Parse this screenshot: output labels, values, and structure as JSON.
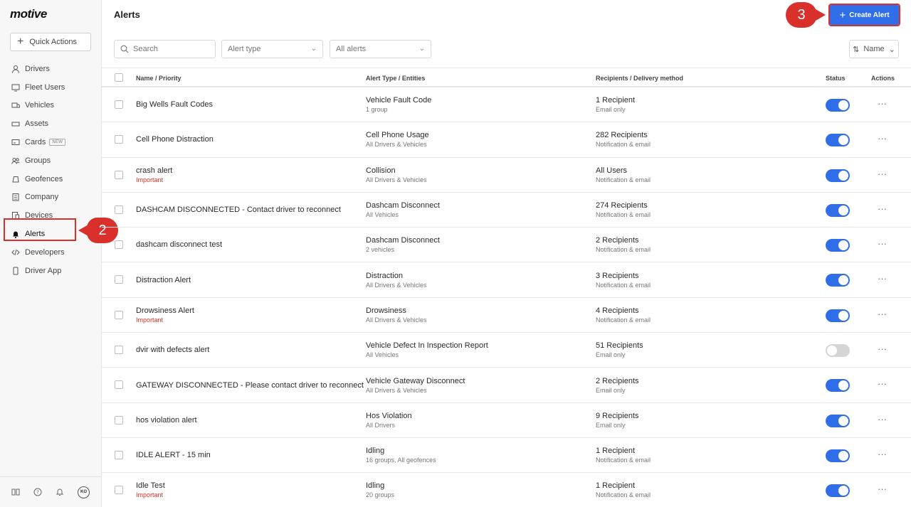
{
  "app": {
    "logo": "motive",
    "page_title": "Alerts"
  },
  "sidebar": {
    "quick_actions": "Quick Actions",
    "items": [
      {
        "label": "Drivers",
        "icon": "user-icon"
      },
      {
        "label": "Fleet Users",
        "icon": "monitor-icon"
      },
      {
        "label": "Vehicles",
        "icon": "vehicle-icon"
      },
      {
        "label": "Assets",
        "icon": "asset-icon"
      },
      {
        "label": "Cards",
        "icon": "card-icon",
        "badge": "NEW"
      },
      {
        "label": "Groups",
        "icon": "groups-icon"
      },
      {
        "label": "Geofences",
        "icon": "geofence-icon"
      },
      {
        "label": "Company",
        "icon": "building-icon"
      },
      {
        "label": "Devices",
        "icon": "devices-icon"
      },
      {
        "label": "Alerts",
        "icon": "bell-icon",
        "active": true
      },
      {
        "label": "Developers",
        "icon": "code-icon"
      },
      {
        "label": "Driver App",
        "icon": "phone-icon"
      }
    ],
    "footer": {
      "avatar": "KO"
    }
  },
  "markers": {
    "step2": "2",
    "step3": "3"
  },
  "toolbar": {
    "create_alert": "Create Alert",
    "search_placeholder": "Search",
    "alert_type": "Alert type",
    "all_alerts": "All alerts",
    "sort": "Name"
  },
  "table": {
    "headers": {
      "name": "Name / Priority",
      "type": "Alert Type / Entities",
      "recipients": "Recipients / Delivery method",
      "status": "Status",
      "actions": "Actions"
    },
    "rows": [
      {
        "name": "Big Wells Fault Codes",
        "priority": "",
        "type": "Vehicle Fault Code",
        "entities": "1 group",
        "recipients": "1 Recipient",
        "delivery": "Email only",
        "enabled": true
      },
      {
        "name": "Cell Phone Distraction",
        "priority": "",
        "type": "Cell Phone Usage",
        "entities": "All Drivers & Vehicles",
        "recipients": "282 Recipients",
        "delivery": "Notification & email",
        "enabled": true
      },
      {
        "name": "crash alert",
        "priority": "Important",
        "type": "Collision",
        "entities": "All Drivers & Vehicles",
        "recipients": "All Users",
        "delivery": "Notification & email",
        "enabled": true
      },
      {
        "name": "DASHCAM DISCONNECTED - Contact driver to reconnect",
        "priority": "",
        "type": "Dashcam Disconnect",
        "entities": "All Vehicles",
        "recipients": "274 Recipients",
        "delivery": "Notification & email",
        "enabled": true
      },
      {
        "name": "dashcam disconnect test",
        "priority": "",
        "type": "Dashcam Disconnect",
        "entities": "2 vehicles",
        "recipients": "2 Recipients",
        "delivery": "Notification & email",
        "enabled": true
      },
      {
        "name": "Distraction Alert",
        "priority": "",
        "type": "Distraction",
        "entities": "All Drivers & Vehicles",
        "recipients": "3 Recipients",
        "delivery": "Notification & email",
        "enabled": true
      },
      {
        "name": "Drowsiness Alert",
        "priority": "Important",
        "type": "Drowsiness",
        "entities": "All Drivers & Vehicles",
        "recipients": "4 Recipients",
        "delivery": "Notification & email",
        "enabled": true
      },
      {
        "name": "dvir with defects alert",
        "priority": "",
        "type": "Vehicle Defect In Inspection Report",
        "entities": "All Vehicles",
        "recipients": "51 Recipients",
        "delivery": "Email only",
        "enabled": false
      },
      {
        "name": "GATEWAY DISCONNECTED - Please contact driver to reconnect",
        "priority": "",
        "type": "Vehicle Gateway Disconnect",
        "entities": "All Drivers & Vehicles",
        "recipients": "2 Recipients",
        "delivery": "Email only",
        "enabled": true
      },
      {
        "name": "hos violation alert",
        "priority": "",
        "type": "Hos Violation",
        "entities": "All Drivers",
        "recipients": "9 Recipients",
        "delivery": "Email only",
        "enabled": true
      },
      {
        "name": "IDLE ALERT - 15 min",
        "priority": "",
        "type": "Idling",
        "entities": "16 groups, All geofences",
        "recipients": "1 Recipient",
        "delivery": "Notification & email",
        "enabled": true
      },
      {
        "name": "Idle Test",
        "priority": "Important",
        "type": "Idling",
        "entities": "20 groups",
        "recipients": "1 Recipient",
        "delivery": "Notification & email",
        "enabled": true
      }
    ],
    "actions_glyph": "···"
  }
}
